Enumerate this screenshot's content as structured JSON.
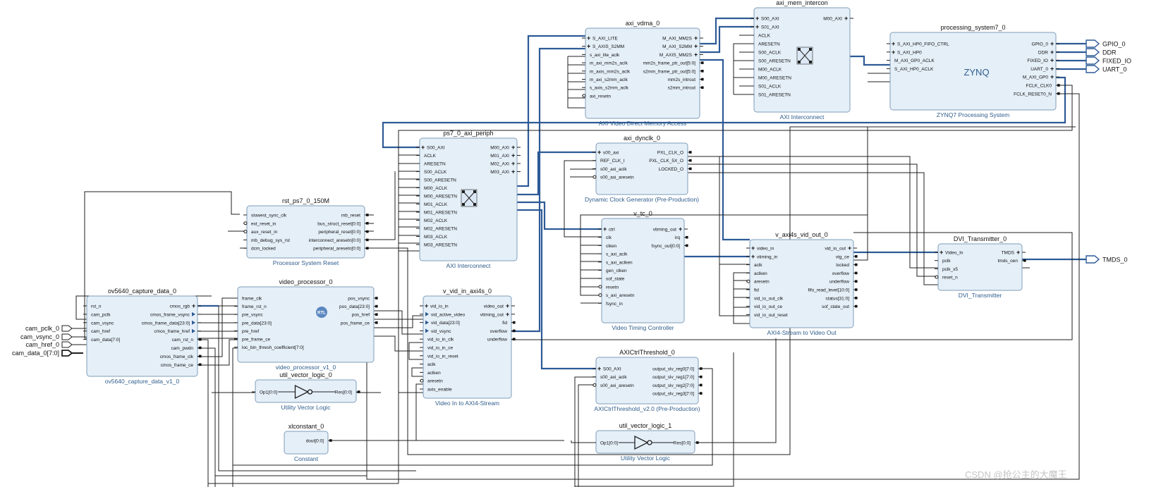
{
  "blocks": [
    {
      "name": "axi_vdma_0",
      "subtitle": "AXI Video Direct Memory Access",
      "left": [
        {
          "label": "S_AXI_LITE",
          "m": "plus"
        },
        {
          "label": "S_AXIS_S2MM",
          "m": "plus"
        },
        {
          "label": "s_axi_lite_aclk"
        },
        {
          "label": "m_axi_mm2s_aclk"
        },
        {
          "label": "m_axis_mm2s_aclk"
        },
        {
          "label": "m_axi_s2mm_aclk"
        },
        {
          "label": "s_axis_s2mm_aclk"
        },
        {
          "label": "axi_resetn",
          "m": "circ"
        }
      ],
      "right": [
        {
          "label": "M_AXI_MM2S",
          "m": "plus"
        },
        {
          "label": "M_AXI_S2MM",
          "m": "plus"
        },
        {
          "label": "M_AXIS_MM2S",
          "m": "plus"
        },
        {
          "label": "mm2s_frame_ptr_out[5:0]"
        },
        {
          "label": "s2mm_frame_ptr_out[5:0]"
        },
        {
          "label": "mm2s_introut"
        },
        {
          "label": "s2mm_introut"
        }
      ]
    },
    {
      "name": "axi_mem_intercon",
      "subtitle": "AXI Interconnect",
      "left": [
        {
          "label": "S00_AXI",
          "m": "plus"
        },
        {
          "label": "S01_AXI",
          "m": "plus"
        },
        {
          "label": "ACLK"
        },
        {
          "label": "ARESETN"
        },
        {
          "label": "S00_ACLK"
        },
        {
          "label": "S00_ARESETN"
        },
        {
          "label": "M00_ACLK"
        },
        {
          "label": "M00_ARESETN"
        },
        {
          "label": "S01_ACLK"
        },
        {
          "label": "S01_ARESETN"
        }
      ],
      "right": [
        {
          "label": "M00_AXI",
          "m": "plus"
        }
      ]
    },
    {
      "name": "processing_system7_0",
      "subtitle": "ZYNQ7 Processing System",
      "logo": "ZYNQ",
      "left": [
        {
          "label": "S_AXI_HP0_FIFO_CTRL",
          "m": "plus"
        },
        {
          "label": "S_AXI_HP0",
          "m": "plus"
        },
        {
          "label": "M_AXI_GP0_ACLK"
        },
        {
          "label": "S_AXI_HP0_ACLK"
        }
      ],
      "right": [
        {
          "label": "GPIO_0",
          "m": "plus"
        },
        {
          "label": "DDR",
          "m": "plus"
        },
        {
          "label": "FIXED_IO",
          "m": "plus"
        },
        {
          "label": "UART_0",
          "m": "plus"
        },
        {
          "label": "M_AXI_GP0",
          "m": "plus"
        },
        {
          "label": "FCLK_CLK0"
        },
        {
          "label": "FCLK_RESET0_N"
        }
      ]
    },
    {
      "name": "ps7_0_axi_periph",
      "subtitle": "AXI Interconnect",
      "left": [
        {
          "label": "S00_AXI",
          "m": "plus"
        },
        {
          "label": "ACLK"
        },
        {
          "label": "ARESETN"
        },
        {
          "label": "S00_ACLK"
        },
        {
          "label": "S00_ARESETN"
        },
        {
          "label": "M00_ACLK"
        },
        {
          "label": "M00_ARESETN"
        },
        {
          "label": "M01_ACLK"
        },
        {
          "label": "M01_ARESETN"
        },
        {
          "label": "M02_ACLK"
        },
        {
          "label": "M02_ARESETN"
        },
        {
          "label": "M03_ACLK"
        },
        {
          "label": "M03_ARESETN"
        }
      ],
      "right": [
        {
          "label": "M00_AXI",
          "m": "plus"
        },
        {
          "label": "M01_AXI",
          "m": "plus"
        },
        {
          "label": "M02_AXI",
          "m": "plus"
        },
        {
          "label": "M03_AXI",
          "m": "plus"
        }
      ]
    },
    {
      "name": "axi_dynclk_0",
      "subtitle": "Dynamic Clock Generator (Pre-Production)",
      "left": [
        {
          "label": "s00_axi",
          "m": "plus"
        },
        {
          "label": "REF_CLK_I"
        },
        {
          "label": "s00_axi_aclk"
        },
        {
          "label": "s00_axi_aresetn",
          "m": "circ"
        }
      ],
      "right": [
        {
          "label": "PXL_CLK_O"
        },
        {
          "label": "PXL_CLK_5X_O"
        },
        {
          "label": "LOCKED_O"
        }
      ]
    },
    {
      "name": "rst_ps7_0_150M",
      "subtitle": "Processor System Reset",
      "left": [
        {
          "label": "slowest_sync_clk"
        },
        {
          "label": "ext_reset_in",
          "m": "circ"
        },
        {
          "label": "aux_reset_in",
          "m": "circ"
        },
        {
          "label": "mb_debug_sys_rst"
        },
        {
          "label": "dcm_locked"
        }
      ],
      "right": [
        {
          "label": "mb_reset"
        },
        {
          "label": "bus_struct_reset[0:0]"
        },
        {
          "label": "peripheral_reset[0:0]"
        },
        {
          "label": "interconnect_aresetn[0:0]"
        },
        {
          "label": "peripheral_aresetn[0:0]"
        }
      ]
    },
    {
      "name": "v_tc_0",
      "subtitle": "Video Timing Controller",
      "left": [
        {
          "label": "ctrl",
          "m": "plus"
        },
        {
          "label": "clk"
        },
        {
          "label": "clken"
        },
        {
          "label": "s_axi_aclk"
        },
        {
          "label": "s_axi_aclken"
        },
        {
          "label": "gen_clken"
        },
        {
          "label": "sof_state"
        },
        {
          "label": "resetn",
          "m": "circ"
        },
        {
          "label": "s_axi_aresetn",
          "m": "circ"
        },
        {
          "label": "fsync_in"
        }
      ],
      "right": [
        {
          "label": "vtiming_out",
          "m": "plus"
        },
        {
          "label": "irq"
        },
        {
          "label": "fsync_out[0:0]"
        }
      ]
    },
    {
      "name": "v_axi4s_vid_out_0",
      "subtitle": "AXI4-Stream to Video Out",
      "left": [
        {
          "label": "video_in",
          "m": "plus"
        },
        {
          "label": "vtiming_in",
          "m": "plus"
        },
        {
          "label": "aclk"
        },
        {
          "label": "aclken"
        },
        {
          "label": "aresetn",
          "m": "circ"
        },
        {
          "label": "fid"
        },
        {
          "label": "vid_io_out_clk"
        },
        {
          "label": "vid_io_out_ce"
        },
        {
          "label": "vid_io_out_reset"
        }
      ],
      "right": [
        {
          "label": "vid_io_out",
          "m": "plus"
        },
        {
          "label": "vtg_ce"
        },
        {
          "label": "locked"
        },
        {
          "label": "overflow"
        },
        {
          "label": "underflow"
        },
        {
          "label": "fifo_read_level[10:0]"
        },
        {
          "label": "status[31:0]"
        },
        {
          "label": "sof_state_out"
        }
      ]
    },
    {
      "name": "DVI_Transmitter_0",
      "subtitle": "DVI_Transmitter",
      "left": [
        {
          "label": "Video_In",
          "m": "plus"
        },
        {
          "label": "pclk"
        },
        {
          "label": "pclk_x5"
        },
        {
          "label": "reset_n",
          "m": "circ"
        }
      ],
      "right": [
        {
          "label": "TMDS",
          "m": "plus"
        },
        {
          "label": "tmds_oen"
        }
      ]
    },
    {
      "name": "ov5640_capture_data_0",
      "subtitle": "ov5640_capture_data_v1_0",
      "left": [
        {
          "label": "rst_n"
        },
        {
          "label": "cam_pclk"
        },
        {
          "label": "cam_vsync"
        },
        {
          "label": "cam_href"
        },
        {
          "label": "cam_data[7:0]"
        }
      ],
      "right": [
        {
          "label": "cmos_rgb",
          "m": "plus"
        },
        {
          "label": "cmos_frame_vsync",
          "m": "arrow"
        },
        {
          "label": "cmos_frame_data[23:0]",
          "m": "arrow"
        },
        {
          "label": "cmos_frame_href",
          "m": "arrow"
        },
        {
          "label": "cam_rst_n"
        },
        {
          "label": "cam_pwdn"
        },
        {
          "label": "cmos_frame_clk"
        },
        {
          "label": "cmos_frame_ce"
        }
      ]
    },
    {
      "name": "video_processor_0",
      "subtitle": "video_processor_v1_0",
      "logo": "RTL",
      "left": [
        {
          "label": "frame_clk"
        },
        {
          "label": "frame_rst_n"
        },
        {
          "label": "pre_vsync"
        },
        {
          "label": "pre_data[23:0]"
        },
        {
          "label": "pre_href"
        },
        {
          "label": "pre_frame_ce"
        },
        {
          "label": "loc_bin_thresh_coefficient[7:0]"
        }
      ],
      "right": [
        {
          "label": "pos_vsync"
        },
        {
          "label": "pos_data[23:0]"
        },
        {
          "label": "pos_href"
        },
        {
          "label": "pos_frame_ce"
        }
      ]
    },
    {
      "name": "v_vid_in_axi4s_0",
      "subtitle": "Video In to AXI4-Stream",
      "left": [
        {
          "label": "vid_io_in",
          "m": "plus"
        },
        {
          "label": "vid_active_video",
          "m": "arrow"
        },
        {
          "label": "vid_data[23:0]",
          "m": "arrow"
        },
        {
          "label": "vid_vsync",
          "m": "arrow"
        },
        {
          "label": "vid_io_in_clk"
        },
        {
          "label": "vid_io_in_ce"
        },
        {
          "label": "vid_io_in_reset"
        },
        {
          "label": "aclk"
        },
        {
          "label": "aclken"
        },
        {
          "label": "aresetn",
          "m": "circ"
        },
        {
          "label": "axis_enable"
        }
      ],
      "right": [
        {
          "label": "video_out",
          "m": "plus"
        },
        {
          "label": "vtiming_out",
          "m": "plus"
        },
        {
          "label": "fid"
        },
        {
          "label": "overflow"
        },
        {
          "label": "underflow"
        }
      ]
    },
    {
      "name": "util_vector_logic_0",
      "subtitle": "Utility Vector Logic",
      "logo": "NOT",
      "left": [
        {
          "label": "Op1[0:0]"
        }
      ],
      "right": [
        {
          "label": "Res[0:0]"
        }
      ]
    },
    {
      "name": "AXICtrlThreshold_0",
      "subtitle": "AXICtrlThreshold_v2.0 (Pre-Production)",
      "left": [
        {
          "label": "S00_AXI",
          "m": "plus"
        },
        {
          "label": "s00_axi_aclk"
        },
        {
          "label": "s00_axi_aresetn",
          "m": "circ"
        }
      ],
      "right": [
        {
          "label": "output_slv_reg0[7:0]"
        },
        {
          "label": "output_slv_reg1[7:0]"
        },
        {
          "label": "output_slv_reg2[7:0]"
        },
        {
          "label": "output_slv_reg3[7:0]"
        }
      ]
    },
    {
      "name": "xlconstant_0",
      "subtitle": "Constant",
      "left": [],
      "right": [
        {
          "label": "dout[0:0]"
        }
      ]
    },
    {
      "name": "util_vector_logic_1",
      "subtitle": "Utility Vector Logic",
      "logo": "NOT",
      "left": [
        {
          "label": "Op1[0:0]"
        }
      ],
      "right": [
        {
          "label": "Res[0:0]"
        }
      ]
    }
  ],
  "external_inputs": [
    "cam_pclk_0",
    "cam_vsync_0",
    "cam_href_0",
    "cam_data_0[7:0]"
  ],
  "external_outputs": [
    "GPIO_0",
    "DDR",
    "FIXED_IO",
    "UART_0",
    "TMDS_0"
  ],
  "watermark": "CSDN @抢公主的大魔王",
  "colors": {
    "block_fill": "#e5eff8",
    "block_border": "#7f9db9",
    "wire": "#1f1f1f",
    "bus": "#2d5a96",
    "subtitle": "#2f5d8c"
  }
}
